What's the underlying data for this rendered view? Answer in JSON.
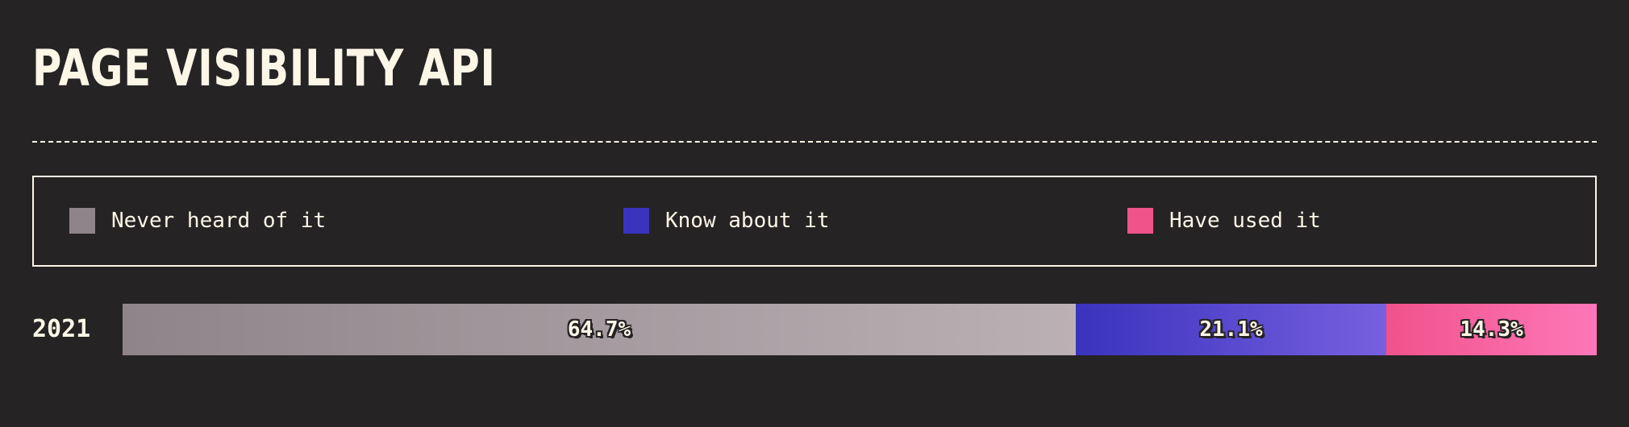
{
  "title": "PAGE VISIBILITY API",
  "chart_data": {
    "type": "bar",
    "stacked": true,
    "orientation": "horizontal",
    "categories": [
      "2021"
    ],
    "series": [
      {
        "name": "Never heard of it",
        "values": [
          64.7
        ],
        "label": "64.7%",
        "color": "#8e8489",
        "color_end": "#bbb1b5"
      },
      {
        "name": "Know about it",
        "values": [
          21.1
        ],
        "label": "21.1%",
        "color": "#3a33bd",
        "color_end": "#7760e0"
      },
      {
        "name": "Have used it",
        "values": [
          14.3
        ],
        "label": "14.3%",
        "color": "#f0528a",
        "color_end": "#fe77b8"
      }
    ],
    "unit": "%",
    "xlim": [
      0,
      100.1
    ],
    "legend_position": "top"
  }
}
